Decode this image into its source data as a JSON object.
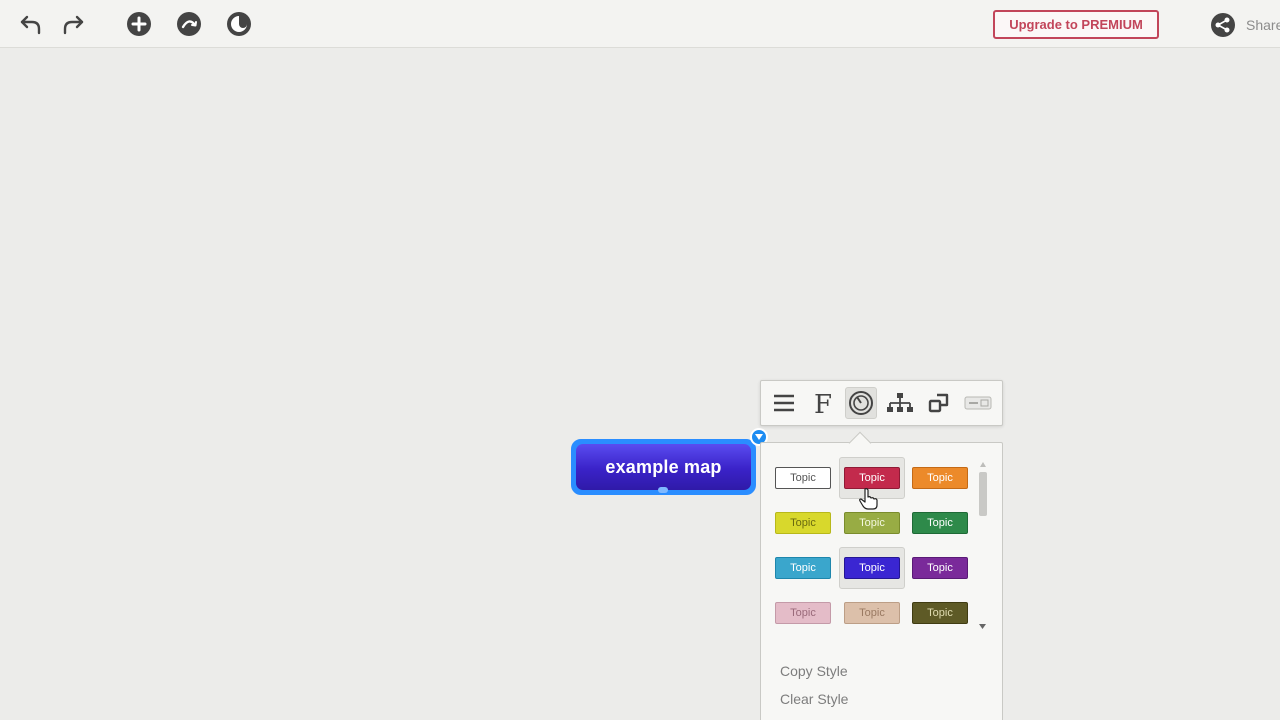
{
  "toolbar": {
    "icons": [
      "undo-icon",
      "redo-icon",
      "add-topic-icon",
      "relation-icon",
      "theme-icon",
      "share-icon"
    ],
    "premium_label": "Upgrade to PREMIUM",
    "share_label": "Share"
  },
  "node": {
    "label": "example map"
  },
  "format_panel": {
    "tabs": [
      "text-align-icon",
      "font-icon",
      "style-icon",
      "structure-icon",
      "shape-icon",
      "relation-line-icon"
    ],
    "active_tab": "style-icon",
    "styles": [
      {
        "label": "Topic",
        "bg": "#ffffff",
        "fg": "#555555",
        "border": "#555555"
      },
      {
        "label": "Topic",
        "bg": "#c32a4c",
        "fg": "#ffffff",
        "border": "#8f1a35"
      },
      {
        "label": "Topic",
        "bg": "#ec8a2a",
        "fg": "#ffffff",
        "border": "#c46a16"
      },
      {
        "label": "Topic",
        "bg": "#d8d82c",
        "fg": "#6a6a10",
        "border": "#b8b81a"
      },
      {
        "label": "Topic",
        "bg": "#98ac44",
        "fg": "#f4f8e0",
        "border": "#7a8c2c"
      },
      {
        "label": "Topic",
        "bg": "#2e8a4a",
        "fg": "#ffffff",
        "border": "#1e6a36"
      },
      {
        "label": "Topic",
        "bg": "#3aa6cc",
        "fg": "#ffffff",
        "border": "#1e86ac"
      },
      {
        "label": "Topic",
        "bg": "#3a26d2",
        "fg": "#ffffff",
        "border": "#241694"
      },
      {
        "label": "Topic",
        "bg": "#7a2a9a",
        "fg": "#ffffff",
        "border": "#5a1a76"
      },
      {
        "label": "Topic",
        "bg": "#e4bcc8",
        "fg": "#9a6a7a",
        "border": "#c49aa8"
      },
      {
        "label": "Topic",
        "bg": "#dcc0aa",
        "fg": "#9a7a62",
        "border": "#bc9e86"
      },
      {
        "label": "Topic",
        "bg": "#5e5a26",
        "fg": "#e0dcb0",
        "border": "#403c12"
      }
    ],
    "selected_style_index": 7,
    "hover_style_index": 1,
    "copy_style_label": "Copy Style",
    "clear_style_label": "Clear Style"
  }
}
